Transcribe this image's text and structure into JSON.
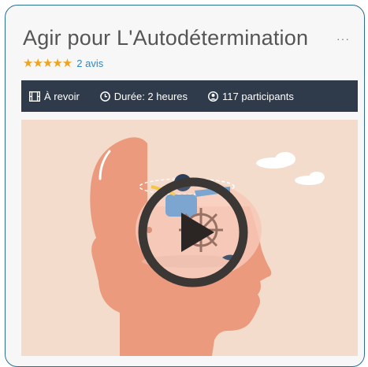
{
  "course": {
    "title": "Agir pour L'Autodétermination",
    "more": "···",
    "rating": {
      "stars": "★★★★★",
      "value": 5,
      "reviews_label": "2 avis"
    }
  },
  "infobar": {
    "replay_label": "À revoir",
    "duration_label": "Durée: 2 heures",
    "participants_label": "117 participants"
  },
  "colors": {
    "accent_border": "#2b6e8f",
    "infobar_bg": "#2f3b4b",
    "star": "#f0a31e",
    "link": "#2f87c4",
    "video_bg": "#f3dccb"
  },
  "icons": [
    "film-icon",
    "clock-icon",
    "user-circle-icon",
    "play-icon",
    "more-icon"
  ]
}
